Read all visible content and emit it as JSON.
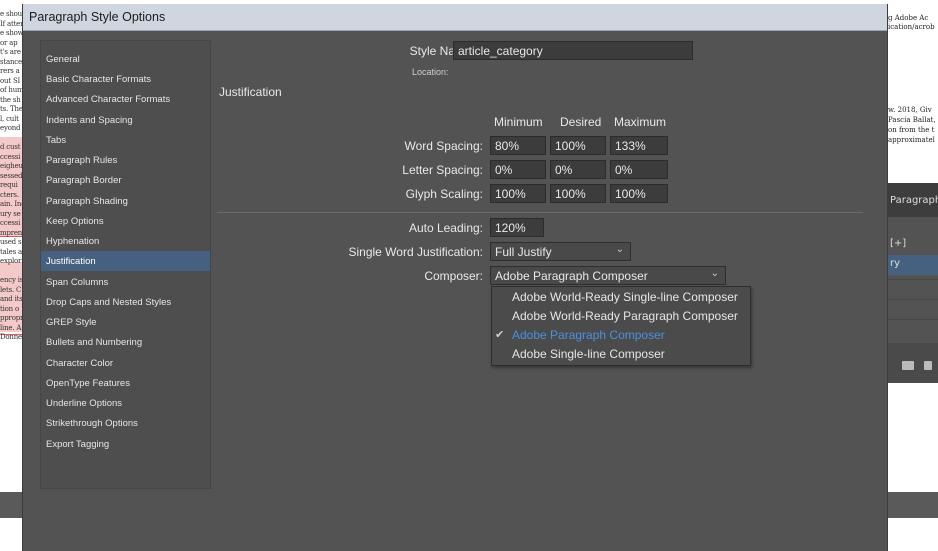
{
  "dialog": {
    "title": "Paragraph Style Options"
  },
  "nav": {
    "items": [
      "General",
      "Basic Character Formats",
      "Advanced Character Formats",
      "Indents and Spacing",
      "Tabs",
      "Paragraph Rules",
      "Paragraph Border",
      "Paragraph Shading",
      "Keep Options",
      "Hyphenation",
      "Justification",
      "Span Columns",
      "Drop Caps and Nested Styles",
      "GREP Style",
      "Bullets and Numbering",
      "Character Color",
      "OpenType Features",
      "Underline Options",
      "Strikethrough Options",
      "Export Tagging"
    ],
    "selected": "Justification"
  },
  "style": {
    "name_label": "Style Name:",
    "name_value": "article_category",
    "location_label": "Location:"
  },
  "justification": {
    "heading": "Justification",
    "col_min": "Minimum",
    "col_desired": "Desired",
    "col_max": "Maximum",
    "word_spacing": {
      "label": "Word Spacing:",
      "min": "80%",
      "desired": "100%",
      "max": "133%"
    },
    "letter_spacing": {
      "label": "Letter Spacing:",
      "min": "0%",
      "desired": "0%",
      "max": "0%"
    },
    "glyph_scaling": {
      "label": "Glyph Scaling:",
      "min": "100%",
      "desired": "100%",
      "max": "100%"
    },
    "auto_leading": {
      "label": "Auto Leading:",
      "value": "120%"
    },
    "single_word": {
      "label": "Single Word Justification:",
      "value": "Full Justify"
    },
    "composer": {
      "label": "Composer:",
      "value": "Adobe Paragraph Composer"
    }
  },
  "composer_menu": {
    "options": [
      "Adobe World-Ready Single-line Composer",
      "Adobe World-Ready Paragraph Composer",
      "Adobe Paragraph Composer",
      "Adobe Single-line Composer"
    ],
    "selected": "Adobe Paragraph Composer"
  },
  "background": {
    "right_panel_title": "Paragraph Styl...",
    "right_panel_row": "[+]",
    "right_panel_selected": "ry",
    "right_text_1": "g Adobe Ac",
    "right_text_2": "ication/acrob",
    "right_text_3": "w. 2018, Giv",
    "right_text_4": "Pascia Ballat,",
    "right_text_5": "on from the t",
    "right_text_6": "approximatel"
  },
  "colors": {
    "dialog_bg": "#535353",
    "selection": "#46617f",
    "menu_active": "#4a90e2",
    "titlebar": "#cfd6df"
  }
}
